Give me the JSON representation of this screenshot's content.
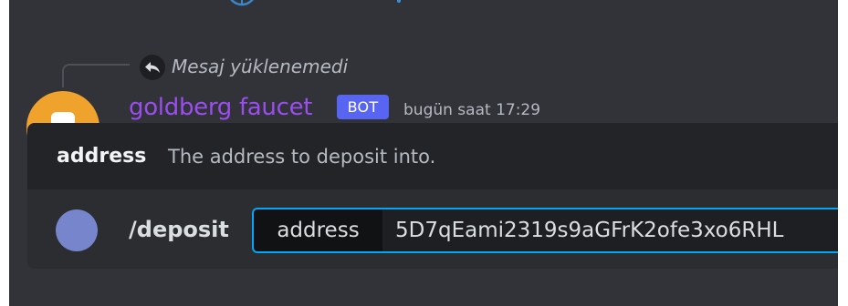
{
  "reply": {
    "icon": "reply-arrow-icon",
    "text": "Mesaj yüklenemedi"
  },
  "message": {
    "username": "goldberg faucet",
    "bot_tag": "BOT",
    "timestamp": "bugün saat 17:29",
    "username_color": "#9b4df0",
    "avatar_color": "#f0a32c"
  },
  "slash_option": {
    "name": "address",
    "description": "The address to deposit into."
  },
  "command": {
    "name": "/deposit",
    "option_label": "address",
    "option_value": "5D7qEami2319s9aGFrK2ofe3xo6RHL",
    "focus_color": "#00a8fc"
  },
  "colors": {
    "background": "#313338",
    "popup": "#2b2d31",
    "popup_header": "#232428",
    "bot_tag": "#5865f2"
  }
}
